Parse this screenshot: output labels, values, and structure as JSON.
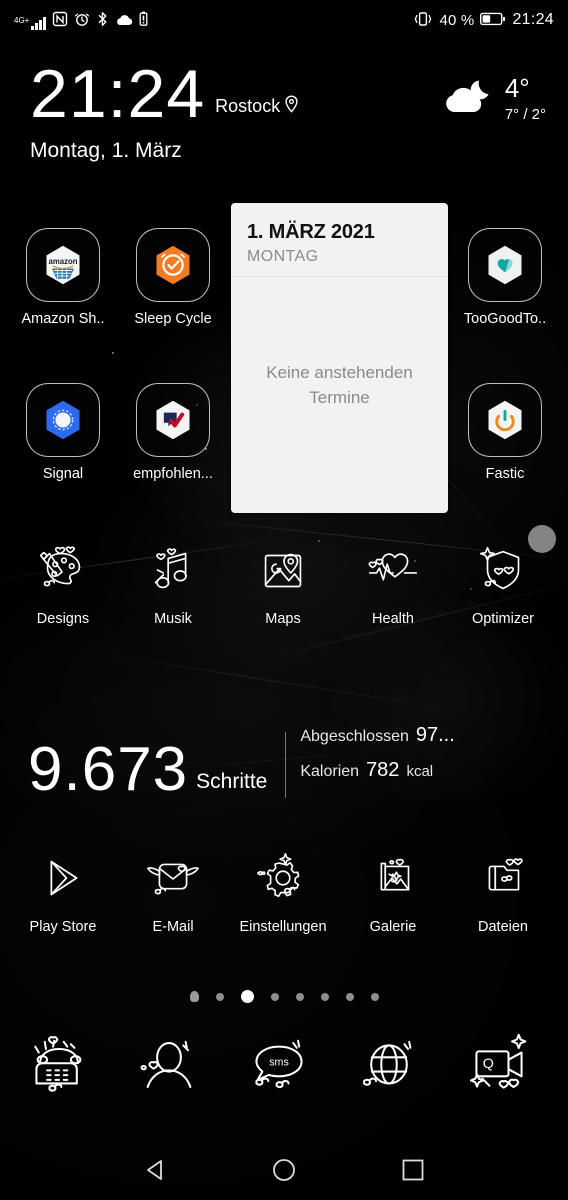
{
  "statusbar": {
    "network_label": "4G",
    "network_plus": "+",
    "icons": [
      "signal-icon",
      "nfc-icon",
      "alarm-icon",
      "bluetooth-icon",
      "cloud-icon",
      "battery-saver-icon",
      "vibrate-icon"
    ],
    "battery_percent": "40 %",
    "time": "21:24"
  },
  "clock_widget": {
    "time": "21:24",
    "city": "Rostock",
    "date": "Montag, 1. März"
  },
  "weather": {
    "icon": "cloud-moon-icon",
    "temp": "4°",
    "range": "7° / 2°"
  },
  "calendar_widget": {
    "date": "1. MÄRZ 2021",
    "weekday": "MONTAG",
    "empty_message": "Keine anstehenden Termine"
  },
  "apps_row1": [
    {
      "label": "Amazon Sh..",
      "icon": "amazon-shopping-icon"
    },
    {
      "label": "Sleep Cycle",
      "icon": "sleep-cycle-icon"
    },
    {
      "label": "TooGoodTo..",
      "icon": "too-good-to-go-icon"
    }
  ],
  "apps_row2": [
    {
      "label": "Signal",
      "icon": "signal-app-icon"
    },
    {
      "label": "empfohlen...",
      "icon": "empfohlen-icon"
    },
    {
      "label": "Fastic",
      "icon": "fastic-icon"
    }
  ],
  "apps_row3": [
    {
      "label": "Designs",
      "icon": "palette-icon"
    },
    {
      "label": "Musik",
      "icon": "music-note-icon"
    },
    {
      "label": "Maps",
      "icon": "maps-pin-icon"
    },
    {
      "label": "Health",
      "icon": "heart-pulse-icon"
    },
    {
      "label": "Optimizer",
      "icon": "shield-icon"
    }
  ],
  "apps_row4": [
    {
      "label": "Play Store",
      "icon": "play-store-icon"
    },
    {
      "label": "E-Mail",
      "icon": "envelope-icon"
    },
    {
      "label": "Einstellungen",
      "icon": "gear-icon"
    },
    {
      "label": "Galerie",
      "icon": "photo-icon"
    },
    {
      "label": "Dateien",
      "icon": "folder-icon"
    }
  ],
  "steps_widget": {
    "count": "9.673",
    "unit": "Schritte",
    "stat1_label": "Abgeschlossen",
    "stat1_value": "97...",
    "stat2_label": "Kalorien",
    "stat2_value": "782",
    "stat2_unit": "kcal"
  },
  "page_indicator": {
    "total": 8,
    "active_index": 2
  },
  "dock": [
    {
      "icon": "phone-icon",
      "label": "Telefon"
    },
    {
      "icon": "contacts-icon",
      "label": "Kontakte"
    },
    {
      "icon": "sms-icon",
      "label": "SMS"
    },
    {
      "icon": "browser-globe-icon",
      "label": "Browser"
    },
    {
      "icon": "camera-icon",
      "label": "Kamera"
    }
  ],
  "navbar": [
    {
      "icon": "back-icon",
      "label": "Zurück"
    },
    {
      "icon": "home-icon",
      "label": "Startseite"
    },
    {
      "icon": "recents-icon",
      "label": "Übersicht"
    }
  ],
  "colors": {
    "background": "#010102",
    "card": "#f2f2f2",
    "card_title": "#111111",
    "card_muted": "#8a8a8a",
    "text": "#ffffff",
    "amazon_blue": "#1a73b8",
    "sleep_orange": "#f47b20",
    "signal_blue": "#2c6bed",
    "empfohlen_red": "#d0021b",
    "empfohlen_navy": "#1b2a55",
    "toogood_teal": "#12a8a0",
    "fastic_orange": "#f08a24"
  }
}
